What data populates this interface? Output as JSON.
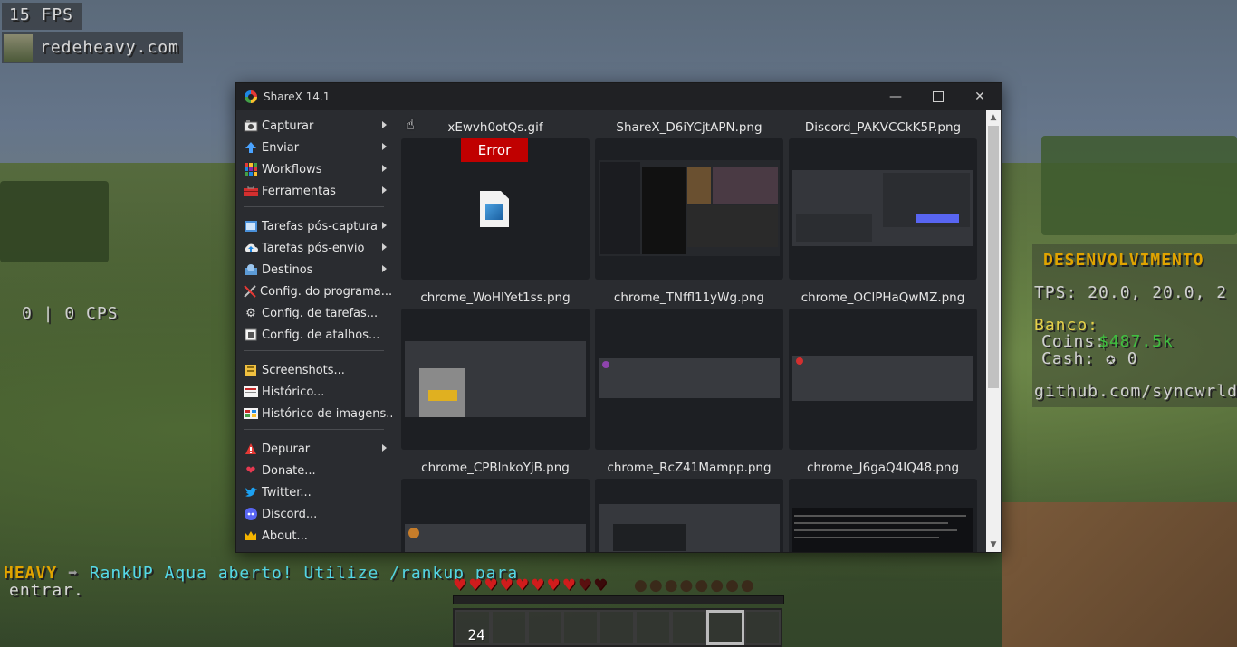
{
  "hud": {
    "fps": "15 FPS",
    "server": "redeheavy.com",
    "cps": "0 | 0 CPS",
    "scoreboard": {
      "title": "DESENVOLVIMENTO",
      "tps": "TPS: 20.0, 20.0, 2",
      "banco": "Banco:",
      "coins_label": "Coins:",
      "coins_value": "$487.5k",
      "cash": "Cash: ✪ 0",
      "github": "github.com/syncwrld"
    },
    "chat": {
      "prefix": "HEAVY",
      "arrow": "➡",
      "line1": "RankUP Aqua aberto! Utilize /rankup para",
      "line2": "entrar."
    },
    "hotbar_count": "24"
  },
  "window": {
    "title": "ShareX 14.1"
  },
  "menu": {
    "items": [
      {
        "label": "Capturar",
        "icon": "camera-icon",
        "submenu": true
      },
      {
        "label": "Enviar",
        "icon": "upload-icon",
        "submenu": true
      },
      {
        "label": "Workflows",
        "icon": "workflows-icon",
        "submenu": true
      },
      {
        "label": "Ferramentas",
        "icon": "toolbox-icon",
        "submenu": true
      },
      {
        "label": "Tarefas pós-captura",
        "icon": "after-capture-icon",
        "submenu": true
      },
      {
        "label": "Tarefas pós-envio",
        "icon": "cloud-upload-icon",
        "submenu": true
      },
      {
        "label": "Destinos",
        "icon": "destinations-icon",
        "submenu": true
      },
      {
        "label": "Config. do programa...",
        "icon": "wrench-icon",
        "submenu": false
      },
      {
        "label": "Config. de tarefas...",
        "icon": "gear-icon",
        "submenu": false
      },
      {
        "label": "Config. de atalhos...",
        "icon": "keyboard-icon",
        "submenu": false
      },
      {
        "label": "Screenshots...",
        "icon": "folder-icon",
        "submenu": false
      },
      {
        "label": "Histórico...",
        "icon": "history-icon",
        "submenu": false
      },
      {
        "label": "Histórico de imagens...",
        "icon": "image-history-icon",
        "submenu": false
      },
      {
        "label": "Depurar",
        "icon": "debug-icon",
        "submenu": true
      },
      {
        "label": "Donate...",
        "icon": "heart-icon",
        "submenu": false
      },
      {
        "label": "Twitter...",
        "icon": "twitter-icon",
        "submenu": false
      },
      {
        "label": "Discord...",
        "icon": "discord-icon",
        "submenu": false
      },
      {
        "label": "About...",
        "icon": "crown-icon",
        "submenu": false
      }
    ]
  },
  "files": [
    {
      "name": "xEwvh0otQs.gif",
      "error": "Error"
    },
    {
      "name": "ShareX_D6iYCjtAPN.png"
    },
    {
      "name": "Discord_PAKVCCkK5P.png"
    },
    {
      "name": "chrome_WoHIYet1ss.png"
    },
    {
      "name": "chrome_TNffl11yWg.png"
    },
    {
      "name": "chrome_OClPHaQwMZ.png"
    },
    {
      "name": "chrome_CPBlnkoYjB.png"
    },
    {
      "name": "chrome_RcZ41Mampp.png"
    },
    {
      "name": "chrome_J6gaQ4IQ48.png"
    }
  ],
  "colors": {
    "error": "#c00000",
    "window_bg": "#2a2c30",
    "titlebar": "#202124"
  }
}
